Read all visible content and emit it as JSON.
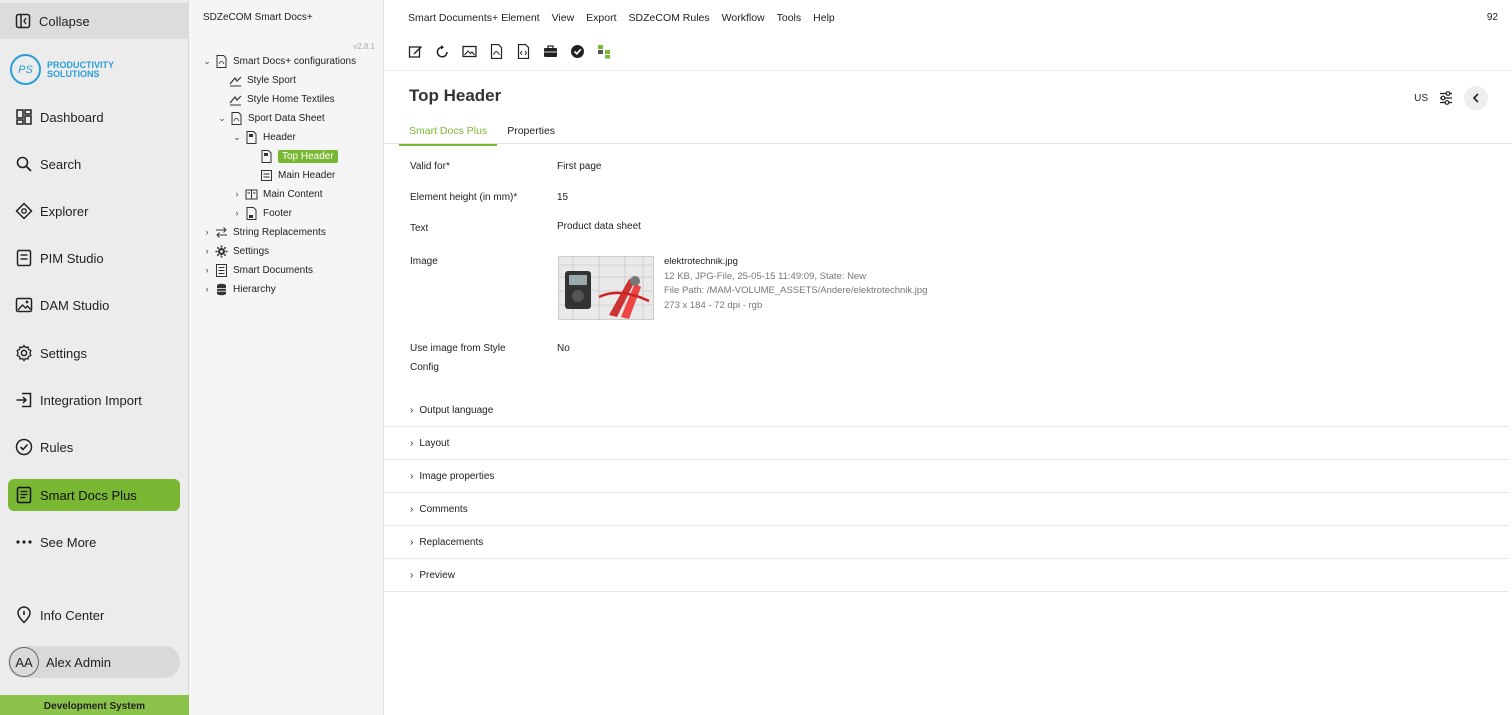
{
  "nav": {
    "collapse_label": "Collapse",
    "logo_initials": "PS",
    "logo_line1": "PRODUCTIVITY",
    "logo_line2": "SOLUTIONS",
    "items": [
      {
        "label": "Dashboard",
        "icon": "dashboard-icon"
      },
      {
        "label": "Search",
        "icon": "search-icon"
      },
      {
        "label": "Explorer",
        "icon": "explorer-icon"
      },
      {
        "label": "PIM Studio",
        "icon": "pim-studio-icon"
      },
      {
        "label": "DAM Studio",
        "icon": "image-icon"
      },
      {
        "label": "Settings",
        "icon": "gear-icon"
      },
      {
        "label": "Integration Import",
        "icon": "import-icon"
      },
      {
        "label": "Rules",
        "icon": "check-circle-icon"
      },
      {
        "label": "Smart Docs Plus",
        "icon": "document-icon",
        "active": true
      },
      {
        "label": "See More",
        "icon": "more-icon"
      }
    ],
    "info_center": "Info Center",
    "user_initials": "AA",
    "user_name": "Alex Admin",
    "system_label": "Development System",
    "accent_color": "#7ab833"
  },
  "tree": {
    "title": "SDZeCOM Smart Docs+",
    "version": "v2.8.1",
    "nodes": [
      {
        "label": "Smart Docs+ configurations",
        "icon": "pdf-icon",
        "expanded": true
      },
      {
        "label": "Style Sport",
        "icon": "style-icon"
      },
      {
        "label": "Style Home Textiles",
        "icon": "style-icon"
      },
      {
        "label": "Sport Data Sheet",
        "icon": "pdf-icon",
        "expanded": true
      },
      {
        "label": "Header",
        "icon": "header-icon",
        "expanded": true
      },
      {
        "label": "Top Header",
        "icon": "header-icon",
        "selected": true
      },
      {
        "label": "Main Header",
        "icon": "page-icon"
      },
      {
        "label": "Main Content",
        "icon": "columns-icon",
        "collapsed": true
      },
      {
        "label": "Footer",
        "icon": "footer-icon",
        "collapsed": true
      },
      {
        "label": "String Replacements",
        "icon": "swap-icon",
        "collapsed": true
      },
      {
        "label": "Settings",
        "icon": "gear-icon",
        "collapsed": true
      },
      {
        "label": "Smart Documents",
        "icon": "list-icon",
        "collapsed": true
      },
      {
        "label": "Hierarchy",
        "icon": "database-icon",
        "collapsed": true
      }
    ]
  },
  "menubar": {
    "items": [
      "Smart Documents+ Element",
      "View",
      "Export",
      "SDZeCOM Rules",
      "Workflow",
      "Tools",
      "Help"
    ],
    "right_text": "92"
  },
  "toolbar": {
    "icons": [
      "edit-icon",
      "reload-icon",
      "preview-image-icon",
      "pdf-icon",
      "code-icon",
      "briefcase-icon",
      "check-badge-icon",
      "hierarchy-icon"
    ]
  },
  "page": {
    "title": "Top Header",
    "locale": "US",
    "tabs": [
      "Smart Docs Plus",
      "Properties"
    ],
    "active_tab": 0
  },
  "form": {
    "valid_for_label": "Valid for*",
    "valid_for_value": "First page",
    "height_label": "Element height (in mm)*",
    "height_value": "15",
    "text_label": "Text",
    "text_value": "Product data sheet",
    "image_label": "Image",
    "image": {
      "filename": "elektrotechnik.jpg",
      "meta": "12 KB, JPG-File, 25-05-15 11:49:09, State: New",
      "path": "File Path: /MAM-VOLUME_ASSETS/Andere/elektrotechnik.jpg",
      "dims": "273 x 184 - 72 dpi - rgb"
    },
    "use_style_label_1": "Use image from Style",
    "use_style_label_2": "Config",
    "use_style_value": "No"
  },
  "sections": [
    "Output language",
    "Layout",
    "Image properties",
    "Comments",
    "Replacements",
    "Preview"
  ]
}
